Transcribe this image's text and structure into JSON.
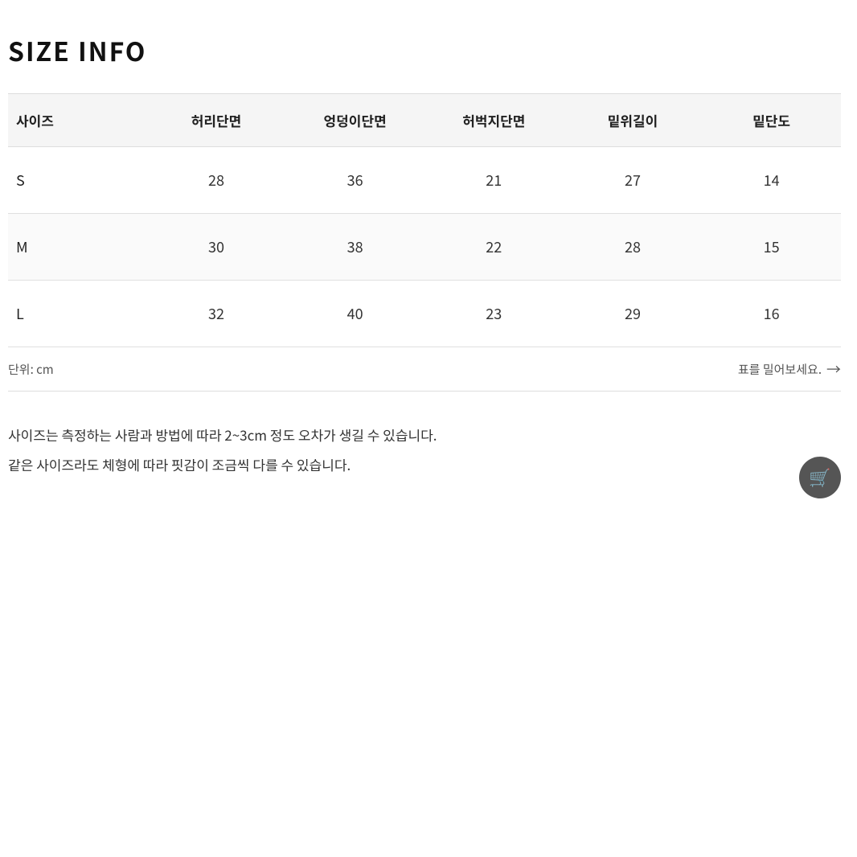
{
  "title": "SIZE INFO",
  "table": {
    "headers": [
      "사이즈",
      "허리단면",
      "엉덩이단면",
      "허벅지단면",
      "밑위길이",
      "밑단도"
    ],
    "rows": [
      {
        "size": "S",
        "waist": "28",
        "hip": "36",
        "thigh": "21",
        "rise": "27",
        "hem": "14"
      },
      {
        "size": "M",
        "waist": "30",
        "hip": "38",
        "thigh": "22",
        "rise": "28",
        "hem": "15"
      },
      {
        "size": "L",
        "waist": "32",
        "hip": "40",
        "thigh": "23",
        "rise": "29",
        "hem": "16"
      }
    ]
  },
  "unit_text": "단위: cm",
  "scroll_hint": "표를 밀어보세요.",
  "notes": [
    "사이즈는 측정하는 사람과 방법에 따라 2~3cm 정도 오차가 생길 수 있습니다.",
    "같은 사이즈라도 체형에 따라 핏감이 조금씩 다를 수 있습니다."
  ]
}
